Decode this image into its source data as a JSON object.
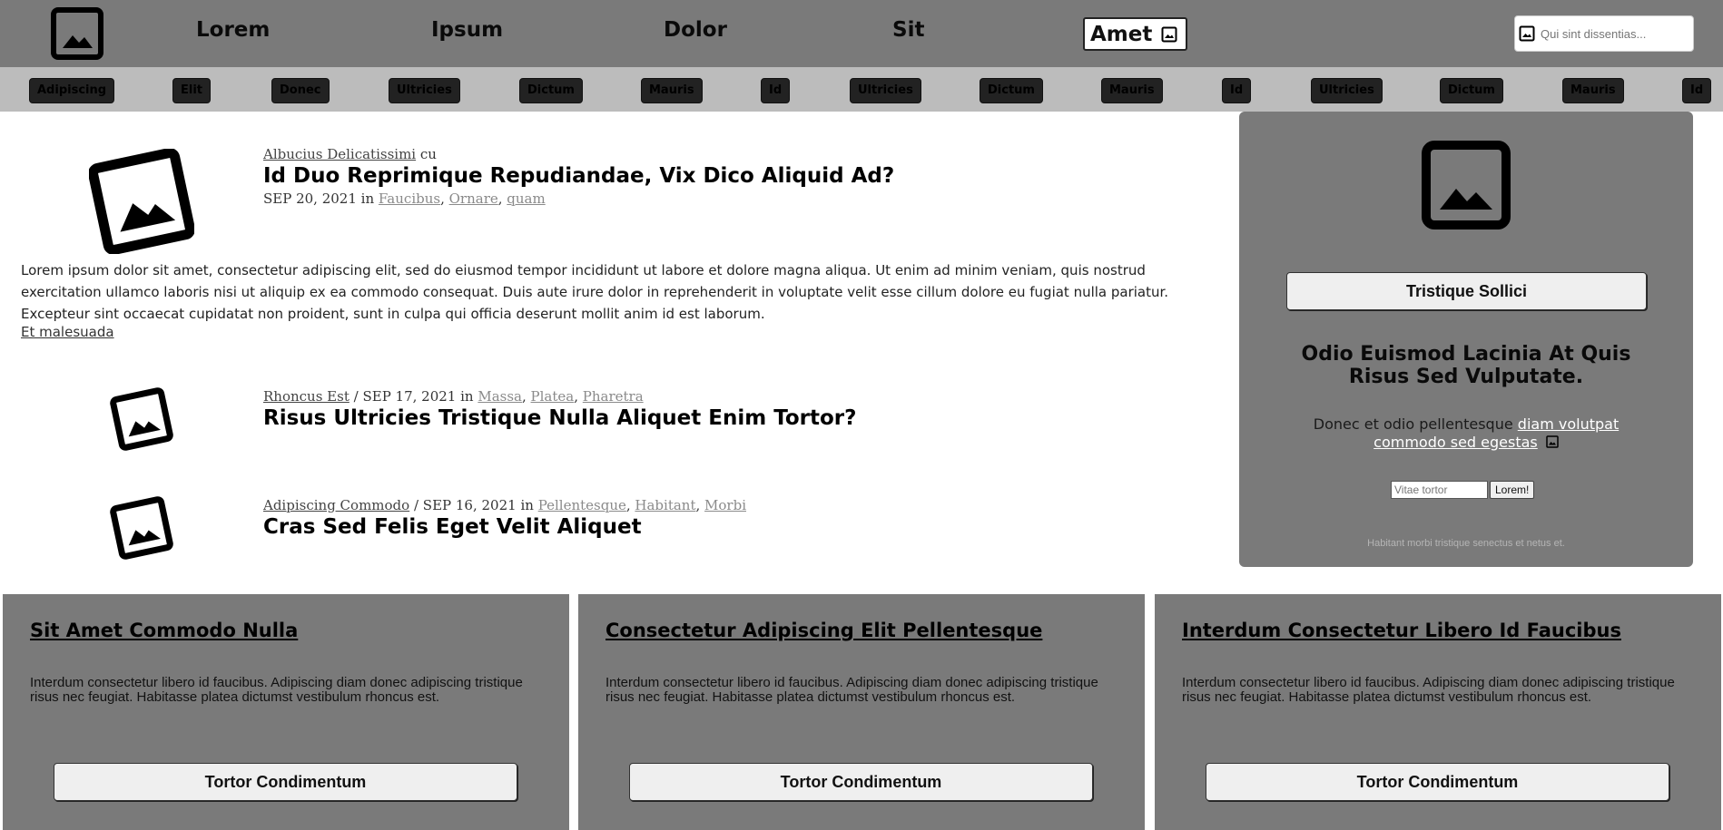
{
  "header": {
    "nav": [
      "Lorem",
      "Ipsum",
      "Dolor",
      "Sit"
    ],
    "active": "Amet",
    "search_placeholder": "Qui sint dissentias..."
  },
  "tags": [
    "Adipiscing",
    "Elit",
    "Donec",
    "Ultricies",
    "Dictum",
    "Mauris",
    "Id",
    "Ultricies",
    "Dictum",
    "Mauris",
    "Id",
    "Ultricies",
    "Dictum",
    "Mauris",
    "Id"
  ],
  "posts": [
    {
      "author": "Albucius Delicatissimi",
      "author_suffix": "cu",
      "title": "Id Duo Reprimique Repudiandae, Vix Dico Aliquid Ad?",
      "date": "SEP 20, 2021",
      "in": "in",
      "cats": [
        "Faucibus",
        "Ornare",
        "quam"
      ],
      "excerpt": "Lorem ipsum dolor sit amet, consectetur adipiscing elit, sed do eiusmod tempor incididunt ut labore et dolore magna aliqua. Ut enim ad minim veniam, quis nostrud exercitation ullamco laboris nisi ut aliquip ex ea commodo consequat. Duis aute irure dolor in reprehenderit in voluptate velit esse cillum dolore eu fugiat nulla pariatur. Excepteur sint occaecat cupidatat non proident, sunt in culpa qui officia deserunt mollit anim id est laborum.",
      "readmore": "Et malesuada"
    },
    {
      "author": "Rhoncus Est",
      "date": "/ SEP 17, 2021 in",
      "cats": [
        "Massa",
        "Platea",
        "Pharetra"
      ],
      "title": "Risus Ultricies Tristique Nulla Aliquet Enim Tortor?"
    },
    {
      "author": "Adipiscing Commodo",
      "date": "/ SEP 16, 2021 in",
      "cats": [
        "Pellentesque",
        "Habitant",
        "Morbi"
      ],
      "title": "Cras Sed Felis Eget Velit Aliquet"
    }
  ],
  "sidebar": {
    "button": "Tristique Sollici",
    "heading": "Odio Euismod Lacinia At Quis Risus Sed Vulputate.",
    "text_prefix": "Donec et odio pellentesque",
    "link": "diam volutpat commodo sed egestas",
    "input_placeholder": "Vitae tortor",
    "submit": "Lorem!",
    "footer": "Habitant morbi tristique senectus et netus et."
  },
  "cards": [
    {
      "title": "Sit Amet Commodo Nulla",
      "text": "Interdum consectetur libero id faucibus. Adipiscing diam donec adipiscing tristique risus nec feugiat. Habitasse platea dictumst vestibulum rhoncus est.",
      "button": "Tortor Condimentum"
    },
    {
      "title": "Consectetur Adipiscing Elit Pellentesque",
      "text": "Interdum consectetur libero id faucibus. Adipiscing diam donec adipiscing tristique risus nec feugiat. Habitasse platea dictumst vestibulum rhoncus est.",
      "button": "Tortor Condimentum"
    },
    {
      "title": "Interdum Consectetur Libero Id Faucibus",
      "text": "Interdum consectetur libero id faucibus. Adipiscing diam donec adipiscing tristique risus nec feugiat. Habitasse platea dictumst vestibulum rhoncus est.",
      "button": "Tortor Condimentum"
    }
  ]
}
